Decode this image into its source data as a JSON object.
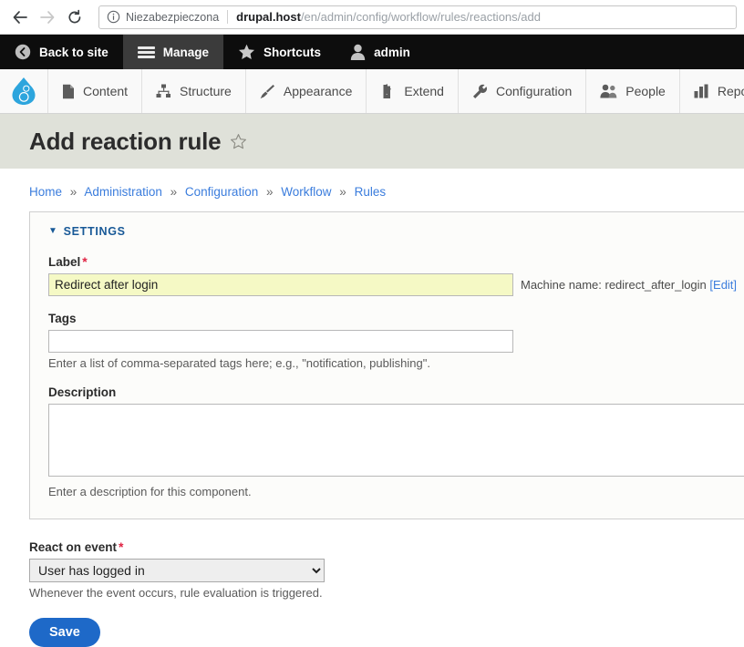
{
  "browser": {
    "back_icon": "back-arrow-icon",
    "forward_icon": "forward-arrow-icon",
    "reload_icon": "reload-icon",
    "security_icon": "info-circle-icon",
    "security_label": "Niezabezpieczona",
    "url_domain": "drupal.host",
    "url_path": "/en/admin/config/workflow/rules/reactions/add"
  },
  "admin_toolbar": {
    "items": [
      {
        "label": "Back to site",
        "icon": "back-circle-icon",
        "active": false
      },
      {
        "label": "Manage",
        "icon": "hamburger-icon",
        "active": true
      },
      {
        "label": "Shortcuts",
        "icon": "star-icon",
        "active": false
      },
      {
        "label": "admin",
        "icon": "user-icon",
        "active": false
      }
    ]
  },
  "admin_menu": {
    "logo": "drupal-droplet-logo",
    "logo_color": "#2da5dd",
    "items": [
      {
        "label": "Content",
        "icon": "document-icon"
      },
      {
        "label": "Structure",
        "icon": "hierarchy-icon"
      },
      {
        "label": "Appearance",
        "icon": "paintbrush-icon"
      },
      {
        "label": "Extend",
        "icon": "puzzle-piece-icon"
      },
      {
        "label": "Configuration",
        "icon": "wrench-icon"
      },
      {
        "label": "People",
        "icon": "people-icon"
      },
      {
        "label": "Reports",
        "icon": "bar-chart-icon"
      }
    ]
  },
  "page": {
    "title": "Add reaction rule",
    "favorite_icon": "star-outline-icon",
    "band_color": "#dfe1d9"
  },
  "breadcrumb": {
    "separator": "»",
    "items": [
      "Home",
      "Administration",
      "Configuration",
      "Workflow",
      "Rules"
    ]
  },
  "settings": {
    "legend": "SETTINGS",
    "collapse_icon": "triangle-down-icon",
    "label_field": {
      "label": "Label",
      "required": true,
      "value": "Redirect after login",
      "placeholder": ""
    },
    "machine_name": {
      "prefix": "Machine name: redirect_after_login",
      "edit_link": "[Edit]"
    },
    "tags_field": {
      "label": "Tags",
      "value": "",
      "placeholder": "",
      "description": "Enter a list of comma-separated tags here; e.g., \"notification, publishing\"."
    },
    "description_field": {
      "label": "Description",
      "value": "",
      "placeholder": "",
      "description": "Enter a description for this component."
    }
  },
  "event": {
    "label": "React on event",
    "required": true,
    "selected": "User has logged in",
    "options": [
      "User has logged in"
    ],
    "description": "Whenever the event occurs, rule evaluation is triggered."
  },
  "actions": {
    "save_label": "Save",
    "save_color": "#1e69c8"
  }
}
